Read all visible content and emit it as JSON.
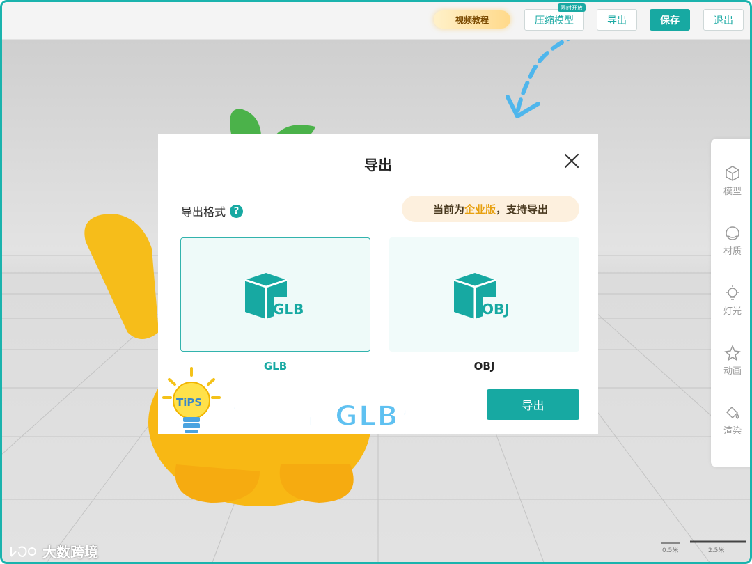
{
  "toolbar": {
    "tutorial_label": "视频教程",
    "compress_label": "压缩模型",
    "compress_badge": "限时开放",
    "export_label": "导出",
    "save_label": "保存",
    "exit_label": "退出"
  },
  "right_panel": {
    "items": [
      {
        "label": "模型",
        "icon": "cube-icon"
      },
      {
        "label": "材质",
        "icon": "material-sphere-icon"
      },
      {
        "label": "灯光",
        "icon": "light-bulb-icon"
      },
      {
        "label": "动画",
        "icon": "animation-icon"
      },
      {
        "label": "渲染",
        "icon": "paint-bucket-icon"
      }
    ]
  },
  "modal": {
    "title": "导出",
    "format_label": "导出格式",
    "help": "?",
    "edition_note_prefix": "当前为",
    "edition_note_highlight": "企业版",
    "edition_note_suffix": "，支持导出",
    "formats": [
      {
        "name": "GLB",
        "badge": "GLB",
        "selected": true
      },
      {
        "name": "OBJ",
        "badge": "OBJ",
        "selected": false
      }
    ],
    "export_button": "导出"
  },
  "tips": {
    "bulb_text": "TiPS",
    "text": "首选导出GLB格式"
  },
  "watermark": "大数跨境",
  "scale": {
    "left": "0.5米",
    "right": "2.5米"
  },
  "colors": {
    "accent": "#17a9a2",
    "frame": "#1ab3ad",
    "tips_text": "#5fc1f1",
    "highlight": "#e7a010"
  }
}
